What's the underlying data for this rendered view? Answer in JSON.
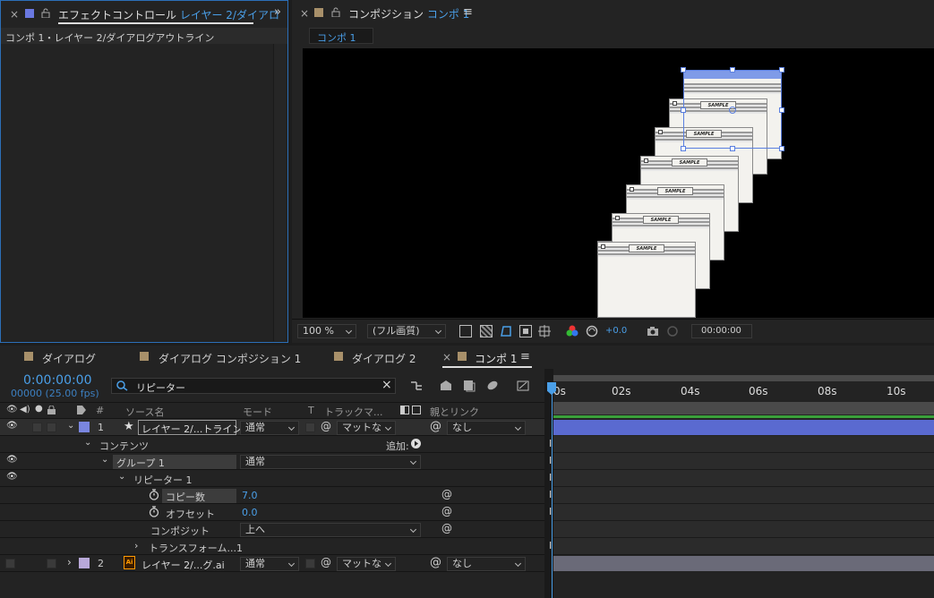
{
  "effect_panel": {
    "close": "×",
    "title": "エフェクトコントロール",
    "layer_name": "レイヤー 2/ダイアロ",
    "subtitle": "コンポ 1・レイヤー 2/ダイアログアウトライン"
  },
  "comp_panel": {
    "close": "×",
    "title": "コンポジション",
    "comp_name": "コンポ 1",
    "tab": "コンポ 1",
    "card_label": "SAMPLE"
  },
  "viewer_toolbar": {
    "zoom": "100 %",
    "quality": "(フル画質)",
    "exposure": "+0.0",
    "timecode": "00:00:00"
  },
  "tabs": [
    {
      "label": "ダイアログ",
      "color": "#a8906a"
    },
    {
      "label": "ダイアログ コンポジション 1",
      "color": "#a8906a"
    },
    {
      "label": "ダイアログ 2",
      "color": "#a8906a"
    },
    {
      "label": "コンポ 1",
      "color": "#a8906a",
      "close": "×"
    }
  ],
  "timeline": {
    "timecode": "0:00:00:00",
    "frames": "00000 (25.00 fps)",
    "search": "リピーター",
    "add_label": "追加:",
    "ruler": [
      "0s",
      "02s",
      "04s",
      "06s",
      "08s",
      "10s"
    ]
  },
  "columns": {
    "num": "#",
    "source": "ソース名",
    "mode": "モード",
    "t": "T",
    "trackmatte": "トラックマ...",
    "parent": "親とリンク"
  },
  "layers": [
    {
      "num": "1",
      "name": "レイヤー 2/...トライン",
      "mode": "通常",
      "matte": "マットな",
      "parent": "なし",
      "color": "#7a86e0"
    },
    {
      "num": "2",
      "name": "レイヤー 2/...グ.ai",
      "mode": "通常",
      "matte": "マットな",
      "parent": "なし",
      "color": "#b8a8d8"
    }
  ],
  "props": {
    "contents": "コンテンツ",
    "group": "グループ 1",
    "group_mode": "通常",
    "repeater": "リピーター 1",
    "copies_label": "コピー数",
    "copies_value": "7.0",
    "offset_label": "オフセット",
    "offset_value": "0.0",
    "composite_label": "コンポジット",
    "composite_value": "上へ",
    "transform_label": "トランスフォーム...1"
  },
  "colors": {
    "accent": "#4a9fe8",
    "layer1": "#5a6ad0",
    "layer2": "#6a6a78",
    "green": "#3aa03a"
  }
}
